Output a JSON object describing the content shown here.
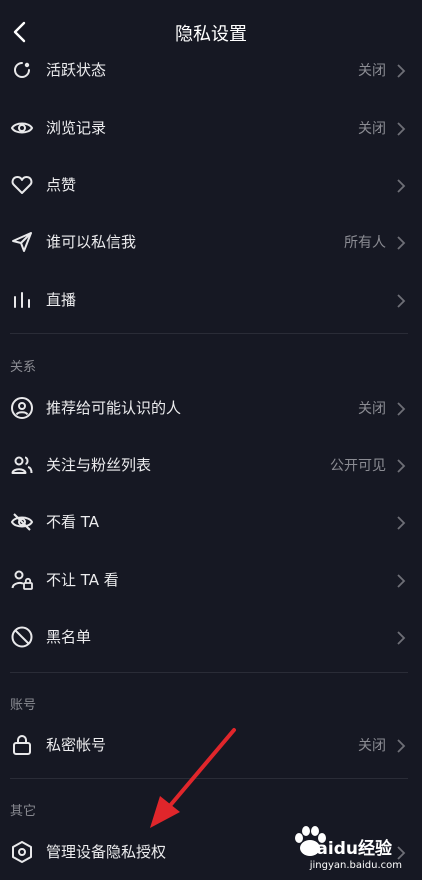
{
  "header": {
    "title": "隐私设置"
  },
  "rows": [
    {
      "label": "活跃状态",
      "value": "关闭",
      "icon": "activity-icon"
    },
    {
      "label": "浏览记录",
      "value": "关闭",
      "icon": "eye-icon"
    },
    {
      "label": "点赞",
      "value": "",
      "icon": "heart-icon"
    },
    {
      "label": "谁可以私信我",
      "value": "所有人",
      "icon": "send-icon"
    },
    {
      "label": "直播",
      "value": "",
      "icon": "live-bars-icon"
    }
  ],
  "sections": {
    "relation": "关系",
    "account": "账号",
    "other": "其它"
  },
  "relation_rows": [
    {
      "label": "推荐给可能认识的人",
      "value": "关闭",
      "icon": "user-circle-icon"
    },
    {
      "label": "关注与粉丝列表",
      "value": "公开可见",
      "icon": "users-icon"
    },
    {
      "label": "不看 TA",
      "value": "",
      "icon": "eye-off-icon"
    },
    {
      "label": "不让 TA 看",
      "value": "",
      "icon": "user-lock-icon"
    },
    {
      "label": "黑名单",
      "value": "",
      "icon": "block-icon"
    }
  ],
  "account_rows": [
    {
      "label": "私密帐号",
      "value": "关闭",
      "icon": "lock-icon"
    }
  ],
  "other_rows": [
    {
      "label": "管理设备隐私授权",
      "value": "",
      "icon": "device-privacy-icon"
    }
  ],
  "watermark": {
    "brand": "Baidu经验",
    "url": "jingyan.baidu.com"
  },
  "colors": {
    "background": "#161823",
    "annotation_arrow": "#e0262b"
  }
}
